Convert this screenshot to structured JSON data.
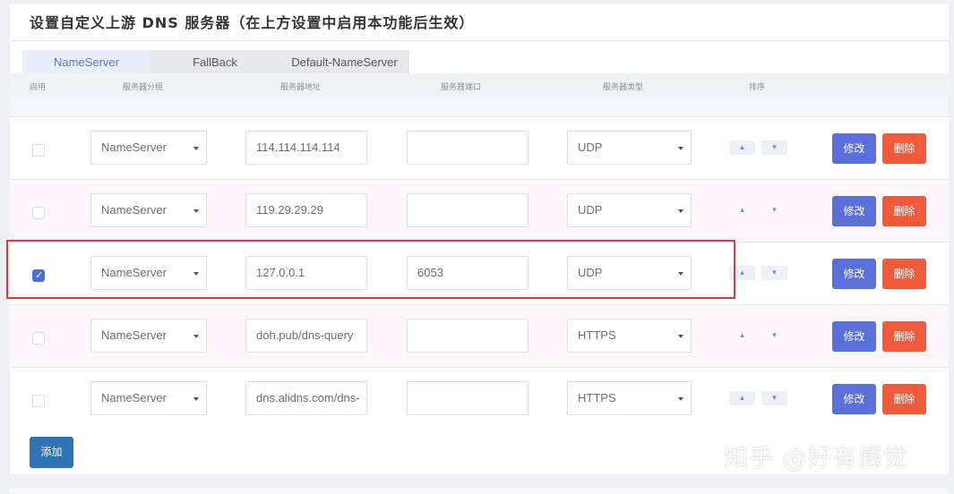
{
  "panel": {
    "title": "设置自定义上游 DNS 服务器（在上方设置中启用本功能后生效）"
  },
  "tabs": [
    {
      "label": "NameServer",
      "active": true
    },
    {
      "label": "FallBack",
      "active": false
    },
    {
      "label": "Default-NameServer",
      "active": false
    }
  ],
  "columns": {
    "enabled": "启用",
    "group": "服务器分组",
    "address": "服务器地址",
    "port": "服务器端口",
    "type": "服务器类型",
    "sort": "排序"
  },
  "rows": [
    {
      "enabled": false,
      "group": "NameServer",
      "address": "114.114.114.114",
      "port": "",
      "type": "UDP"
    },
    {
      "enabled": false,
      "group": "NameServer",
      "address": "119.29.29.29",
      "port": "",
      "type": "UDP"
    },
    {
      "enabled": true,
      "group": "NameServer",
      "address": "127.0.0.1",
      "port": "6053",
      "type": "UDP"
    },
    {
      "enabled": false,
      "group": "NameServer",
      "address": "doh.pub/dns-query",
      "port": "",
      "type": "HTTPS"
    },
    {
      "enabled": false,
      "group": "NameServer",
      "address": "dns.alidns.com/dns-",
      "port": "",
      "type": "HTTPS"
    }
  ],
  "actions": {
    "sort_up": "▴",
    "sort_down": "▾",
    "edit_label": "修改",
    "delete_label": "删除",
    "add_label": "添加"
  },
  "colors": {
    "accent": "#5b6fd9",
    "danger": "#ef5a3a",
    "add_button": "#2f73b5",
    "highlight_box": "#e03a3a"
  },
  "watermark": "知乎 @好有感觉"
}
